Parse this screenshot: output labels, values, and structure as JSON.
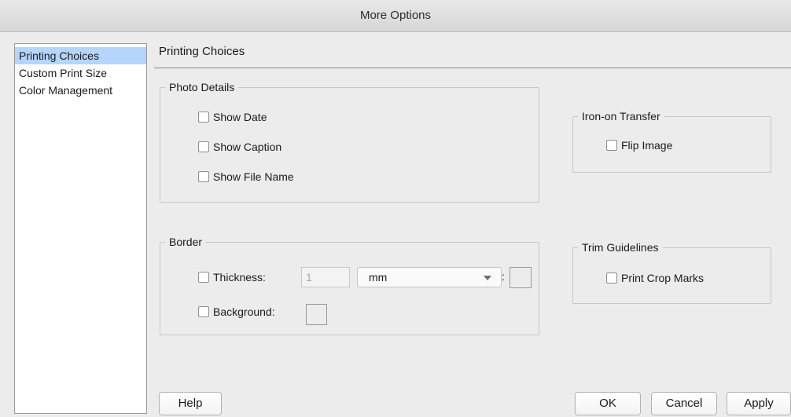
{
  "window": {
    "title": "More Options"
  },
  "sidebar": {
    "items": [
      {
        "label": "Printing Choices",
        "selected": true
      },
      {
        "label": "Custom Print Size",
        "selected": false
      },
      {
        "label": "Color Management",
        "selected": false
      }
    ]
  },
  "panel": {
    "title": "Printing Choices"
  },
  "photo_details": {
    "title": "Photo Details",
    "show_date": {
      "label": "Show Date",
      "checked": false
    },
    "show_caption": {
      "label": "Show Caption",
      "checked": false
    },
    "show_file_name": {
      "label": "Show File Name",
      "checked": false
    }
  },
  "iron_on": {
    "title": "Iron-on Transfer",
    "flip_image": {
      "label": "Flip Image",
      "checked": false
    }
  },
  "border": {
    "title": "Border",
    "thickness": {
      "label": "Thickness:",
      "checked": false,
      "value": "1"
    },
    "unit": {
      "selected": "mm"
    },
    "colon": ":",
    "background": {
      "label": "Background:",
      "checked": false
    }
  },
  "trim": {
    "title": "Trim Guidelines",
    "print_crop_marks": {
      "label": "Print Crop Marks",
      "checked": false
    }
  },
  "buttons": {
    "help": "Help",
    "ok": "OK",
    "cancel": "Cancel",
    "apply": "Apply"
  },
  "colors": {
    "selection": "#b5d5fb",
    "window_bg": "#ececec"
  }
}
